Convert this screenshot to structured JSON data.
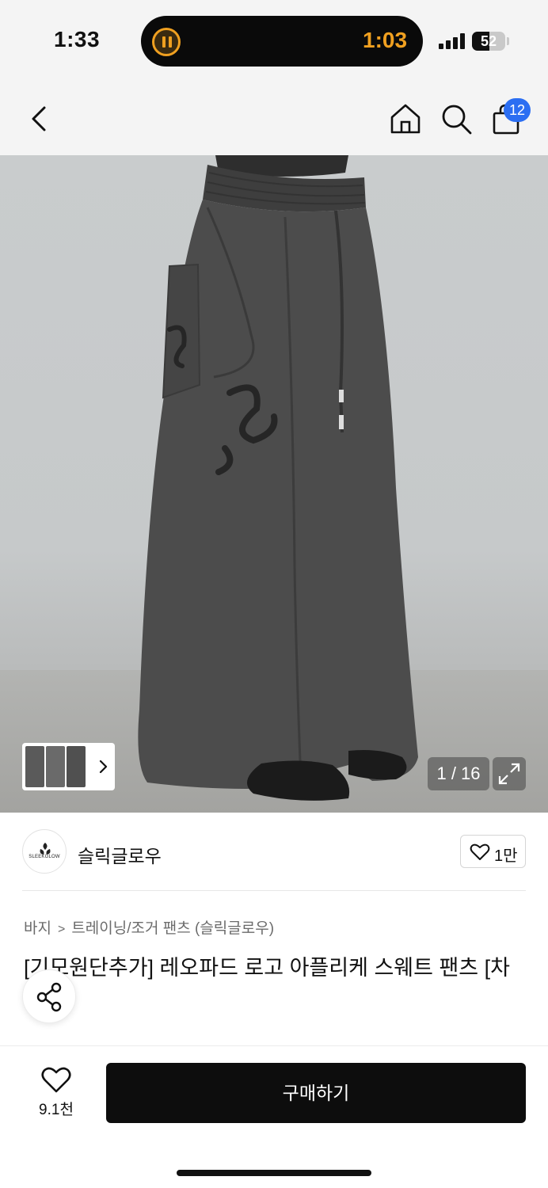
{
  "status_bar": {
    "time": "1:33",
    "timer": "1:03",
    "battery": "52",
    "battery_level": 0.52
  },
  "header": {
    "icons": [
      "chevron-left-icon",
      "home-icon",
      "search-icon",
      "shopping-bag-icon"
    ],
    "cart_count": "12"
  },
  "gallery": {
    "page_counter": "1 / 16",
    "icons": [
      "chevron-right-icon",
      "expand-icon"
    ]
  },
  "brand": {
    "name": "슬릭글로우",
    "logo_text": "SLEEKGLOW",
    "followers": "1만"
  },
  "product": {
    "breadcrumb": [
      "바지",
      "트레이닝/조거 팬츠 (슬릭글로우)"
    ],
    "title": "[기모원단추가] 레오파드 로고 아플리케 스웨트 팬츠 [차콜]"
  },
  "bottom_bar": {
    "wish_count": "9.1천",
    "buy_label": "구매하기"
  },
  "colors": {
    "buy_button": "#0d0d0d",
    "badge": "#2b6ef2",
    "timer": "#f0a020"
  }
}
